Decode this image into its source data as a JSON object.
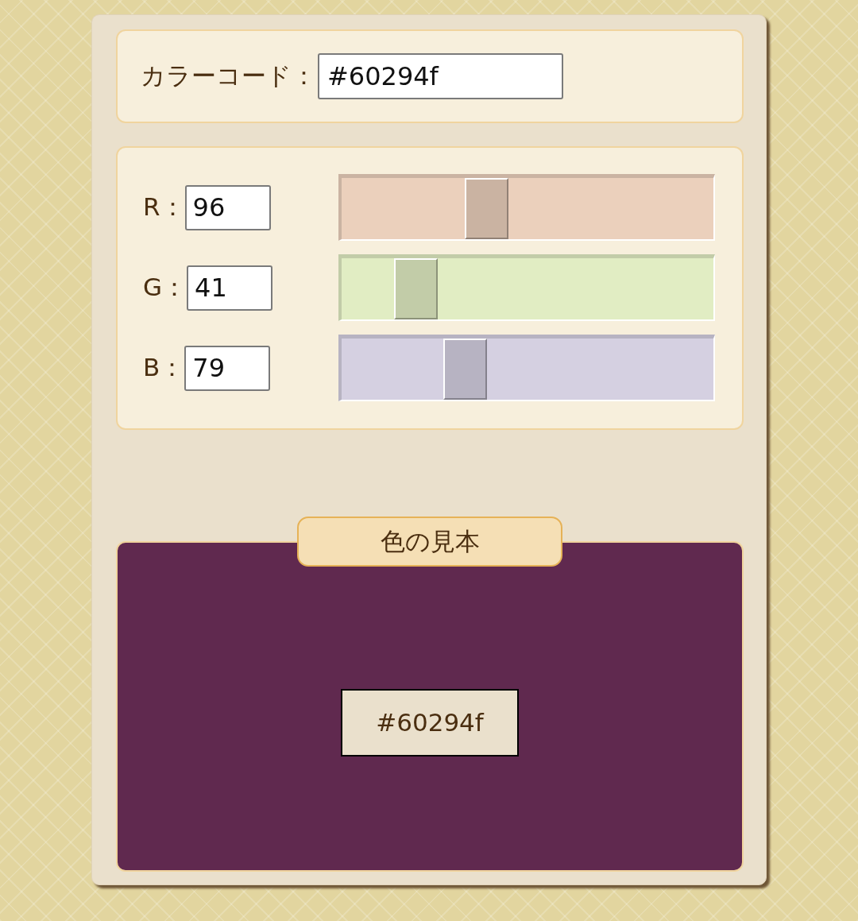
{
  "color_code": {
    "label": "カラーコード：",
    "value": "#60294f"
  },
  "channels": [
    {
      "label": "R：",
      "value": "96",
      "level": 0.376,
      "color": "#ebd0bc"
    },
    {
      "label": "G：",
      "value": "41",
      "level": 0.161,
      "color": "#e1edc3"
    },
    {
      "label": "B：",
      "value": "79",
      "level": 0.31,
      "color": "#d5d0e1"
    }
  ],
  "sample": {
    "title": "色の見本",
    "code": "#60294f"
  }
}
